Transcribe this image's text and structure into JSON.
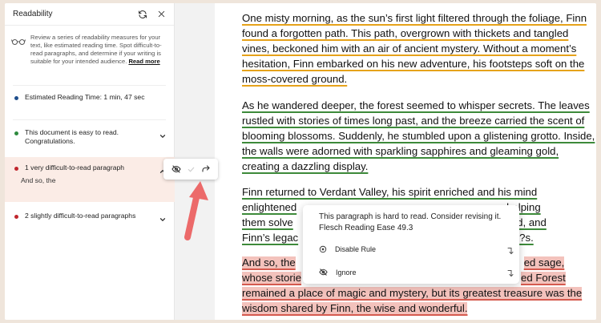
{
  "sidebar": {
    "title": "Readability",
    "intro": "Review a series of readability measures for your text, like estimated reading time. Spot difficult-to-read paragraphs, and determine if your writing is suitable for your intended audience.",
    "read_more": "Read more",
    "items": [
      {
        "label": "Estimated Reading Time: 1 min, 47 sec",
        "dot_color": "#1f4e8c"
      },
      {
        "label": "This document is easy to read. Congratulations.",
        "dot_color": "#2e8a3e"
      },
      {
        "label": "1 very difficult-to-read paragraph",
        "dot_color": "#c0262d",
        "detail": "And so, the"
      },
      {
        "label": "2 slightly difficult-to-read paragraphs",
        "dot_color": "#c0262d"
      }
    ]
  },
  "document": {
    "p1": "One misty morning, as the sun’s first light filtered through the foliage, Finn found a forgotten path. This path, overgrown with thickets and tangled vines, beckoned him with an air of ancient mystery. Without a moment’s hesitation, Finn embarked on his new adventure, his footsteps soft on the moss-covered ground.",
    "p2": "As he wandered deeper, the forest seemed to whisper secrets. The leaves rustled with stories of times long past, and the breeze carried the scent of blooming blossoms. Suddenly, he stumbled upon a glistening grotto. Inside, the walls were adorned with sparkling sapphires and gleaming gold, creating a dazzling display.",
    "p3_l1": "Finn returned to Verdant Valley, his spirit enriched and his mind",
    "p3_l2a": "enlightened",
    "p3_l2b": "s, helping",
    "p3_l3a": "them solve",
    "p3_l3b": "pered, and",
    "p3_l4a": "Finn’s legac",
    "p3_l4b": "?s.",
    "p4_l1a": "And so, the",
    "p4_l1b": "ed sage,",
    "p4_l2a": "whose storie",
    "p4_l2b": "ed Forest",
    "p4_l3": "remained a place of magic and mystery, but its greatest treasure was the",
    "p4_l4": "wisdom shared by Finn, the wise and wonderful."
  },
  "popover": {
    "message": "This paragraph is hard to read. Consider revising it. Flesch Reading Ease 49.3",
    "disable_rule": "Disable Rule",
    "ignore": "Ignore"
  }
}
